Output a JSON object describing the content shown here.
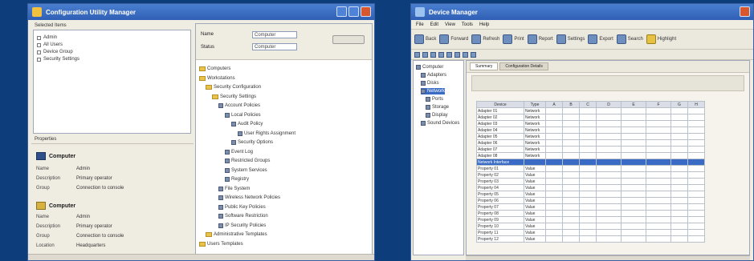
{
  "left_window": {
    "title": "Configuration Utility Manager",
    "list_group_label": "Selected Items",
    "list_items": [
      "Admin",
      "All Users",
      "Device Group",
      "Security Settings"
    ],
    "properties_label": "Properties",
    "section1": {
      "heading": "Computer",
      "rows": [
        {
          "key": "Name",
          "value": "Admin"
        },
        {
          "key": "Description",
          "value": "Primary operator"
        },
        {
          "key": "Group",
          "value": "Connection to console"
        }
      ]
    },
    "section2": {
      "heading": "Computer",
      "rows": [
        {
          "key": "Name",
          "value": "Admin"
        },
        {
          "key": "Description",
          "value": "Primary operator"
        },
        {
          "key": "Group",
          "value": "Connection to console"
        },
        {
          "key": "Location",
          "value": "Headquarters"
        }
      ]
    },
    "form": {
      "label_1": "Name",
      "label_2": "Status",
      "field_1": "Computer",
      "field_2": "Computer",
      "button_label": ""
    },
    "tree": [
      {
        "label": "Computers",
        "level": 0,
        "kind": "folder"
      },
      {
        "label": "Workstations",
        "level": 0,
        "kind": "folder"
      },
      {
        "label": "Security Configuration",
        "level": 1,
        "kind": "folder"
      },
      {
        "label": "Security Settings",
        "level": 2,
        "kind": "folder"
      },
      {
        "label": "Account Policies",
        "level": 3,
        "kind": "node"
      },
      {
        "label": "Local Policies",
        "level": 4,
        "kind": "node"
      },
      {
        "label": "Audit Policy",
        "level": 5,
        "kind": "node"
      },
      {
        "label": "User Rights Assignment",
        "level": 6,
        "kind": "node"
      },
      {
        "label": "Security Options",
        "level": 5,
        "kind": "node"
      },
      {
        "label": "Event Log",
        "level": 4,
        "kind": "node"
      },
      {
        "label": "Restricted Groups",
        "level": 4,
        "kind": "node"
      },
      {
        "label": "System Services",
        "level": 4,
        "kind": "node"
      },
      {
        "label": "Registry",
        "level": 4,
        "kind": "node"
      },
      {
        "label": "File System",
        "level": 3,
        "kind": "node"
      },
      {
        "label": "Wireless Network Policies",
        "level": 3,
        "kind": "node"
      },
      {
        "label": "Public Key Policies",
        "level": 3,
        "kind": "node"
      },
      {
        "label": "Software Restriction",
        "level": 3,
        "kind": "node"
      },
      {
        "label": "IP Security Policies",
        "level": 3,
        "kind": "node"
      },
      {
        "label": "Administrative Templates",
        "level": 1,
        "kind": "folder"
      },
      {
        "label": "Users Templates",
        "level": 0,
        "kind": "folder"
      }
    ]
  },
  "right_window": {
    "title": "Device Manager",
    "menu": [
      "File",
      "Edit",
      "View",
      "Tools",
      "Help"
    ],
    "toolbar": [
      "Back",
      "Forward",
      "Refresh",
      "Print",
      "Report",
      "Settings",
      "Export",
      "Search",
      "Highlight"
    ],
    "tree": [
      {
        "label": "Computer",
        "level": 0
      },
      {
        "label": "Adapters",
        "level": 1
      },
      {
        "label": "Disks",
        "level": 1
      },
      {
        "label": "Network",
        "level": 1,
        "selected": true
      },
      {
        "label": "Ports",
        "level": 2
      },
      {
        "label": "Storage",
        "level": 2
      },
      {
        "label": "Display",
        "level": 2
      },
      {
        "label": "Sound Devices",
        "level": 1
      }
    ],
    "tabs": [
      "Summary",
      "Configuration Details"
    ],
    "table_headers": [
      "Device",
      "Type",
      "A",
      "B",
      "C",
      "D",
      "E",
      "F",
      "G",
      "H"
    ],
    "table_rows": [
      [
        "Adapter 01",
        "Network",
        "",
        "",
        "",
        "",
        "",
        "",
        "",
        ""
      ],
      [
        "Adapter 02",
        "Network",
        "",
        "",
        "",
        "",
        "",
        "",
        "",
        ""
      ],
      [
        "Adapter 03",
        "Network",
        "",
        "",
        "",
        "",
        "",
        "",
        "",
        ""
      ],
      [
        "Adapter 04",
        "Network",
        "",
        "",
        "",
        "",
        "",
        "",
        "",
        ""
      ],
      [
        "Adapter 05",
        "Network",
        "",
        "",
        "",
        "",
        "",
        "",
        "",
        ""
      ],
      [
        "Adapter 06",
        "Network",
        "",
        "",
        "",
        "",
        "",
        "",
        "",
        ""
      ],
      [
        "Adapter 07",
        "Network",
        "",
        "",
        "",
        "",
        "",
        "",
        "",
        ""
      ],
      [
        "Adapter 08",
        "Network",
        "",
        "",
        "",
        "",
        "",
        "",
        "",
        ""
      ]
    ],
    "selected_row": [
      "Network Interface",
      "",
      "",
      "",
      "",
      "",
      "",
      "",
      "",
      ""
    ],
    "lower_rows": [
      [
        "Property 01",
        "Value",
        "",
        "",
        "",
        "",
        "",
        "",
        "",
        ""
      ],
      [
        "Property 02",
        "Value",
        "",
        "",
        "",
        "",
        "",
        "",
        "",
        ""
      ],
      [
        "Property 03",
        "Value",
        "",
        "",
        "",
        "",
        "",
        "",
        "",
        ""
      ],
      [
        "Property 04",
        "Value",
        "",
        "",
        "",
        "",
        "",
        "",
        "",
        ""
      ],
      [
        "Property 05",
        "Value",
        "",
        "",
        "",
        "",
        "",
        "",
        "",
        ""
      ],
      [
        "Property 06",
        "Value",
        "",
        "",
        "",
        "",
        "",
        "",
        "",
        ""
      ],
      [
        "Property 07",
        "Value",
        "",
        "",
        "",
        "",
        "",
        "",
        "",
        ""
      ],
      [
        "Property 08",
        "Value",
        "",
        "",
        "",
        "",
        "",
        "",
        "",
        ""
      ],
      [
        "Property 09",
        "Value",
        "",
        "",
        "",
        "",
        "",
        "",
        "",
        ""
      ],
      [
        "Property 10",
        "Value",
        "",
        "",
        "",
        "",
        "",
        "",
        "",
        ""
      ],
      [
        "Property 11",
        "Value",
        "",
        "",
        "",
        "",
        "",
        "",
        "",
        ""
      ],
      [
        "Property 12",
        "Value",
        "",
        "",
        "",
        "",
        "",
        "",
        "",
        ""
      ]
    ]
  },
  "colors": {
    "background": "#0d3d7a",
    "titlebar": "#2f5fb5",
    "selection": "#3a6bc4",
    "folder": "#e8c44a"
  }
}
